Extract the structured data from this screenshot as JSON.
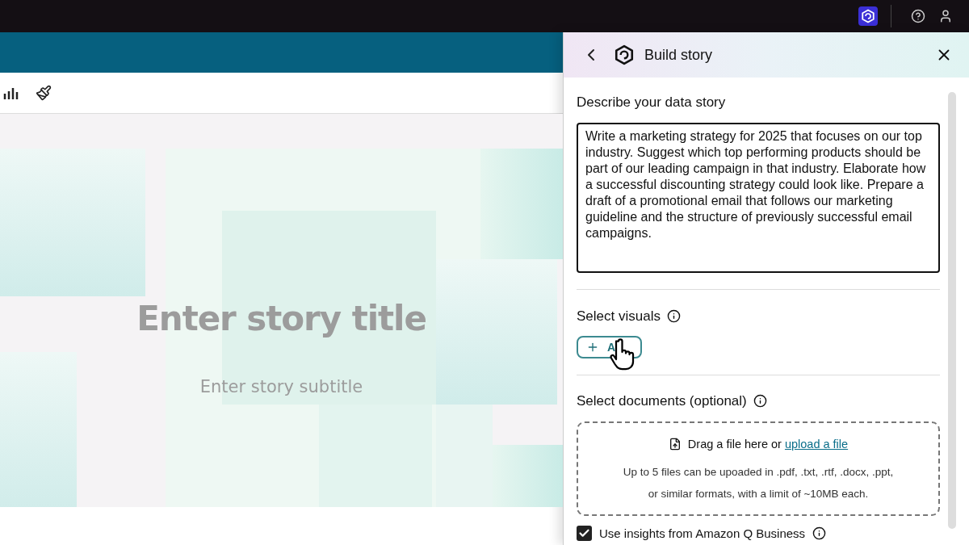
{
  "canvas": {
    "title_placeholder": "Enter story title",
    "subtitle_placeholder": "Enter story subtitle"
  },
  "panel": {
    "title": "Build story",
    "describe": {
      "label": "Describe your data story",
      "value": "Write a marketing strategy for 2025 that focuses on our top industry. Suggest which top performing products should be part of our leading campaign in that industry. Elaborate how a successful discounting strategy could look like. Prepare a draft of a promotional email that follows our marketing guideline and the structure of previously successful email campaigns."
    },
    "visuals": {
      "label": "Select visuals",
      "add_button": "A"
    },
    "documents": {
      "label": "Select documents (optional)",
      "drop_text": "Drag a file here or",
      "link": "upload a file",
      "notes": [
        "Up to 5 files can be upoaded in .pdf, .txt, .rtf, .docx, .ppt,",
        "or similar formats, with a limit of ~10MB each."
      ]
    },
    "insights": {
      "label": "Use insights from Amazon Q Business",
      "checked": true
    }
  }
}
